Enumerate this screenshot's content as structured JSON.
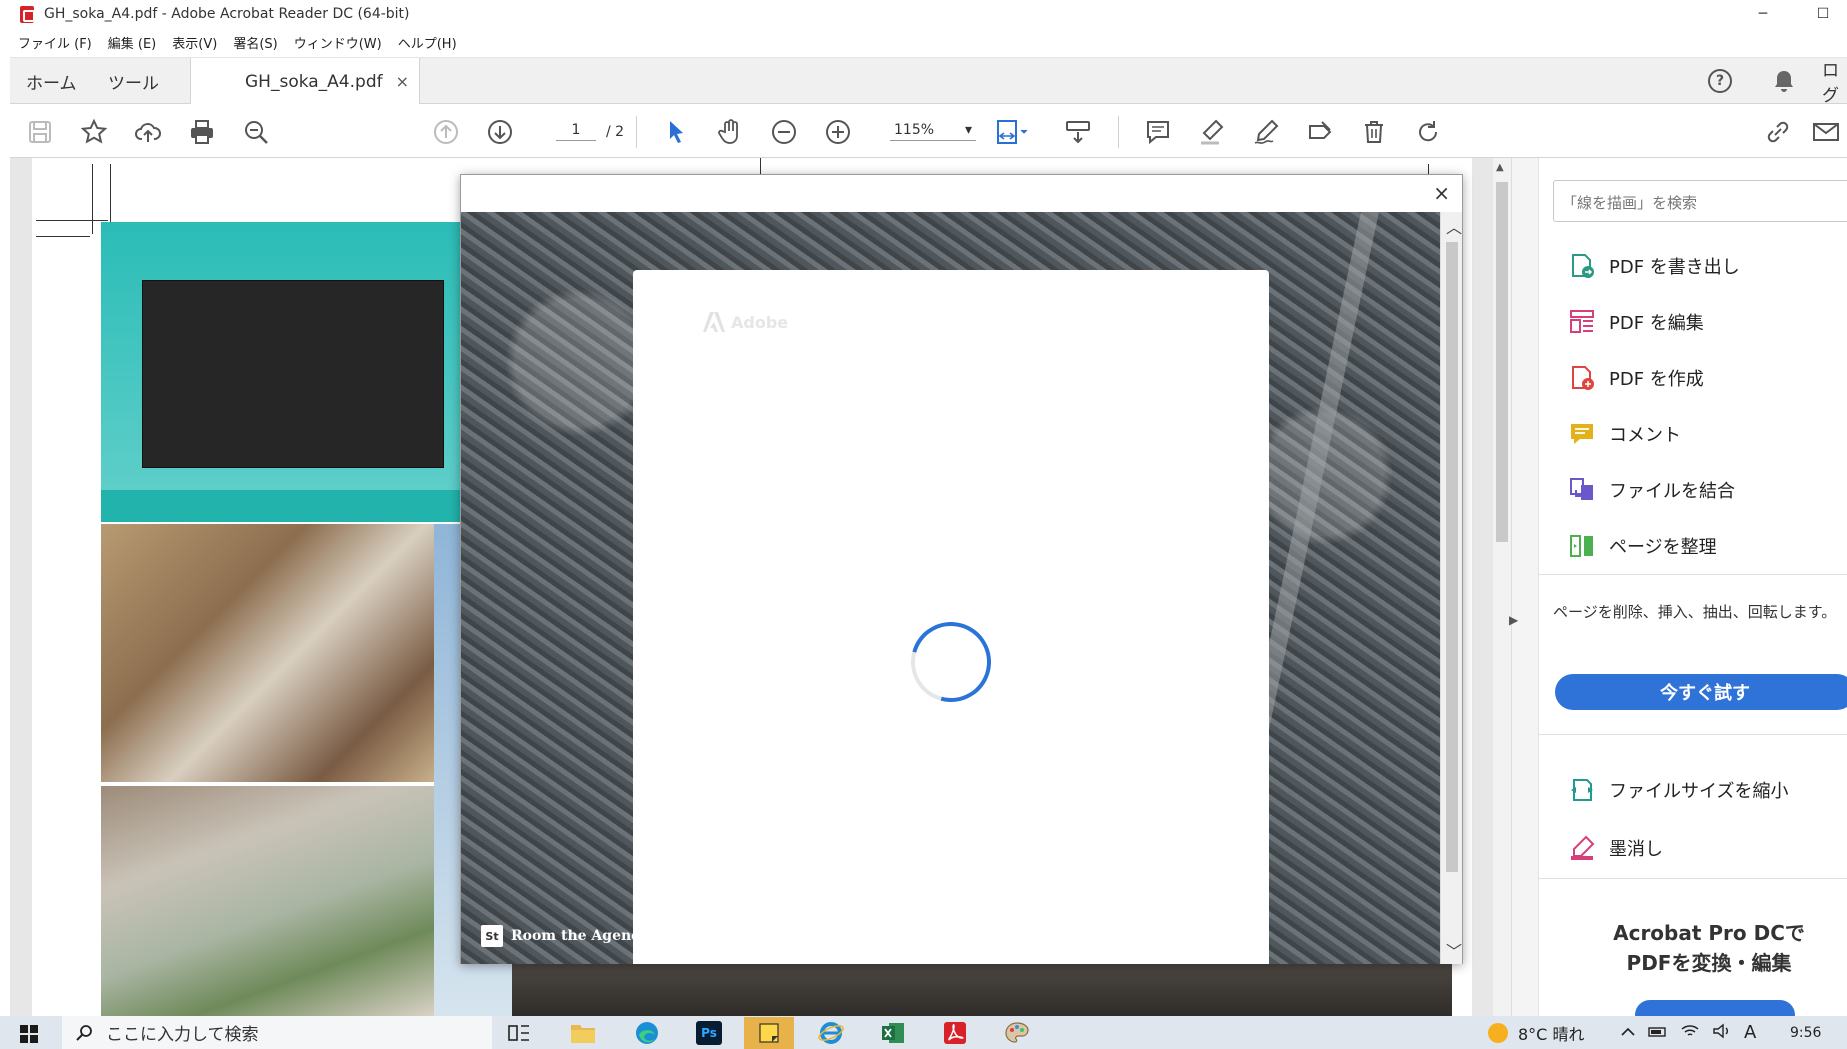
{
  "window": {
    "title": "GH_soka_A4.pdf - Adobe Acrobat Reader DC (64-bit)",
    "minimize": "─",
    "maximize": "☐"
  },
  "menu": [
    "ファイル (F)",
    "編集 (E)",
    "表示(V)",
    "署名(S)",
    "ウィンドウ(W)",
    "ヘルプ(H)"
  ],
  "tabs": {
    "home": "ホーム",
    "tools": "ツール",
    "document": "GH_soka_A4.pdf",
    "close": "×",
    "help": "?",
    "login": "ログ"
  },
  "toolbar": {
    "page_current": "1",
    "page_total": "/ 2",
    "zoom": "115%",
    "zoom_caret": "▾"
  },
  "document": {
    "scroll_up": "▲",
    "collapse_left": "▶"
  },
  "modal": {
    "close": "×",
    "brand": "Adobe",
    "credit": "Room the Agency",
    "credit_badge": "St",
    "scroll_up": "︿",
    "scroll_down": "﹀"
  },
  "right_panel": {
    "search_placeholder": "「線を描画」を検索",
    "collapse": "▶",
    "tools": [
      {
        "label": "PDF を書き出し",
        "icon": "export-pdf-icon",
        "color": "#2a9a84"
      },
      {
        "label": "PDF を編集",
        "icon": "edit-pdf-icon",
        "color": "#d6407a"
      },
      {
        "label": "PDF を作成",
        "icon": "create-pdf-icon",
        "color": "#e0443e"
      },
      {
        "label": "コメント",
        "icon": "comment-icon",
        "color": "#e3b21b"
      },
      {
        "label": "ファイルを結合",
        "icon": "combine-files-icon",
        "color": "#6b57c9"
      },
      {
        "label": "ページを整理",
        "icon": "organize-pages-icon",
        "color": "#4caf50"
      },
      {
        "label": "ファイルサイズを縮小",
        "icon": "compress-pdf-icon",
        "color": "#1f9b8f"
      },
      {
        "label": "墨消し",
        "icon": "redact-icon",
        "color": "#d6407a"
      }
    ],
    "description": "ページを削除、挿入、抽出、回転します。",
    "try_button": "今すぐ試す",
    "promo_line1": "Acrobat Pro DCで",
    "promo_line2": "PDFを変換・編集"
  },
  "taskbar": {
    "search": "ここに入力して検索",
    "apps": [
      "task-view",
      "file-explorer",
      "edge",
      "photoshop",
      "sticky-notes",
      "internet-explorer",
      "excel",
      "acrobat",
      "paint"
    ],
    "ps_label": "Ps",
    "weather": "8°C  晴れ",
    "ime": "A",
    "time": "9:56"
  },
  "colors": {
    "accent_blue": "#2f73d8",
    "acrobat_red": "#d8222a",
    "teal": "#2bbcb7"
  }
}
